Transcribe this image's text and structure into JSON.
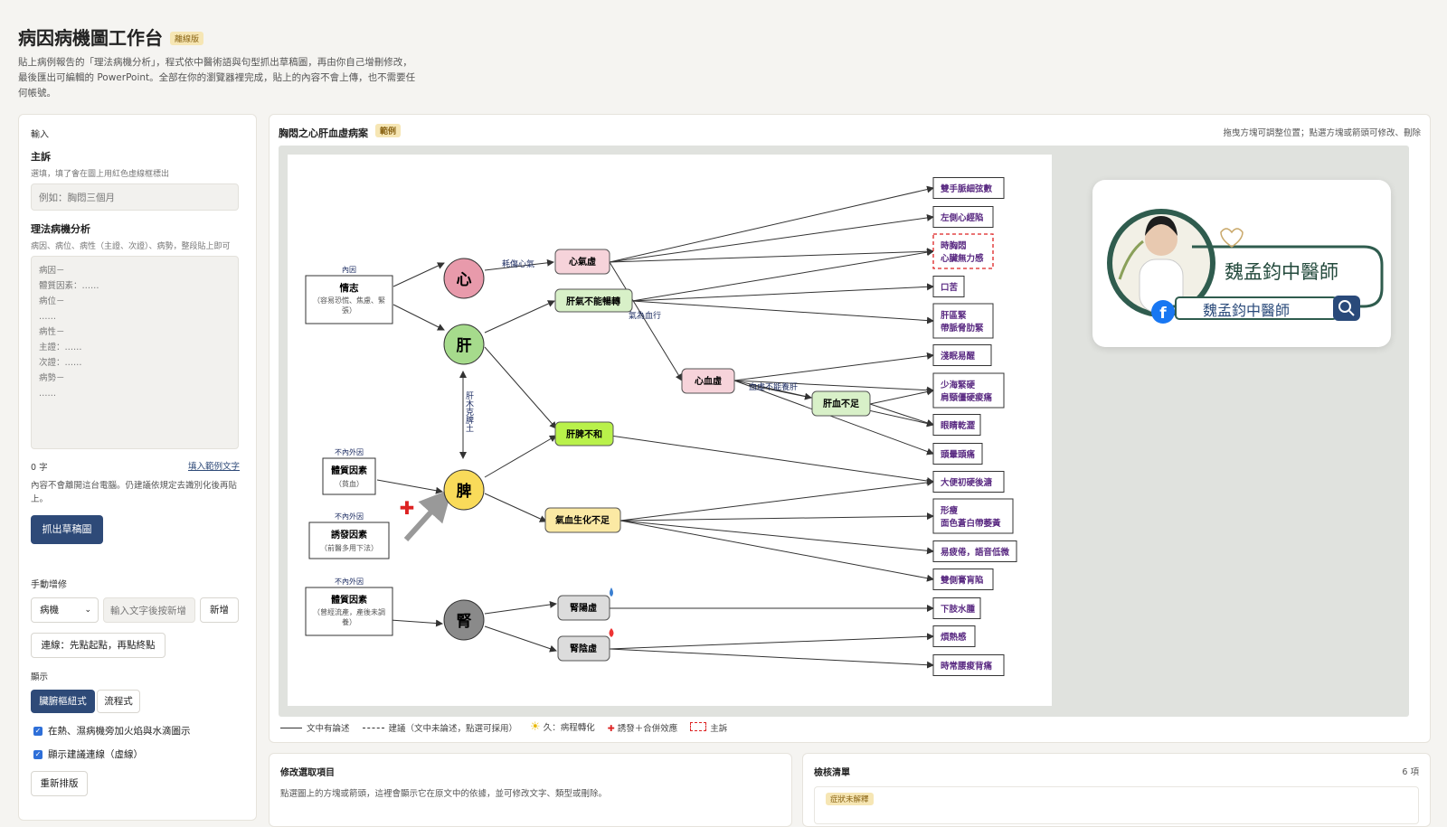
{
  "app": {
    "title": "病因病機圖工作台",
    "badge": "離線版",
    "intro": "貼上病例報告的「理法病機分析」，程式依中醫術語與句型抓出草稿圖，再由你自己增刪修改，最後匯出可編輯的 PowerPoint。全部在你的瀏覽器裡完成，貼上的內容不會上傳，也不需要任何帳號。"
  },
  "left": {
    "heading": "輸入",
    "chief_label": "主訴",
    "chief_hint": "選填，填了會在圖上用紅色虛線框標出",
    "chief_placeholder": "例如：胸悶三個月",
    "analysis_label": "理法病機分析",
    "analysis_hint": "病因、病位、病性（主證、次證）、病勢，整段貼上即可",
    "analysis_placeholder": "病因－\n體質因素：……\n病位－\n……\n病性－\n主證：……\n次證：……\n病勢－\n……",
    "char_count": "0 字",
    "fill_example": "填入範例文字",
    "privacy": "內容不會離開這台電腦。仍建議依規定去識別化後再貼上。",
    "extract_button": "抓出草稿圖",
    "manual_label": "手動增修",
    "type_select": "病機",
    "add_placeholder": "輸入文字後按新增",
    "add_button": "新增",
    "connect_button": "連線：先點起點，再點終點",
    "display_label": "顯示",
    "mode_a": "臟腑樞紐式",
    "mode_b": "流程式",
    "opt1": "在熱、濕病機旁加火焰與水滴圖示",
    "opt2": "顯示建議連線（虛線）",
    "relayout": "重新排版"
  },
  "main": {
    "case_title": "胸悶之心肝血虛病案",
    "case_badge": "範例",
    "hint": "拖曳方塊可調整位置；點選方塊或箭頭可修改、刪除",
    "legend": {
      "solid": "文中有論述",
      "dashed": "建議（文中未論述，點選可採用）",
      "sun": "久：病程轉化",
      "cross": "誘發＋合併效應",
      "chief": "主訴"
    }
  },
  "diagram": {
    "causes": [
      {
        "tag": "內因",
        "title": "情志",
        "sub": "（容易恐慌、焦慮、緊張）"
      },
      {
        "tag": "不內外因",
        "title": "體質因素",
        "sub": "（貧血）"
      },
      {
        "tag": "不內外因",
        "title": "誘發因素",
        "sub": "（前醫多用下法）"
      },
      {
        "tag": "不內外因",
        "title": "體質因素",
        "sub": "（曾經流產，產後未調養）"
      }
    ],
    "organs": {
      "heart": "心",
      "liver": "肝",
      "spleen": "脾",
      "kidney": "腎"
    },
    "mechanisms": {
      "m_heart_qi": "心氣虛",
      "m_liver_qi": "肝氣不能暢轉",
      "m_heart_blood": "心血虛",
      "m_liver_blood": "肝血不足",
      "m_liver_spleen": "肝脾不和",
      "m_qi_blood": "氣血生化不足",
      "m_kidney_yang": "腎陽虛",
      "m_kidney_yin": "腎陰虛"
    },
    "edge_labels": {
      "consume": "耗傷心氣",
      "qi_blood": "氣為血行",
      "blood_nourish": "血虛不能養肝",
      "wood_earth": "肝木克脾土"
    },
    "symptoms": [
      "雙手脈細弦數",
      "左側心經陷",
      "時胸悶\n心臟無力感",
      "口苦",
      "肝區緊\n帶脈脅肋緊",
      "淺眠易醒",
      "少海緊硬\n肩頸僵硬痠痛",
      "眼睛乾澀",
      "頭暈頭痛",
      "大便初硬後溏",
      "形瘦\n面色蒼白帶萎黃",
      "易疲倦，語音低微",
      "雙側膏肓陷",
      "下肢水腫",
      "煩熱感",
      "時常腰痠背痛"
    ]
  },
  "card": {
    "name": "魏孟鈞中醫師",
    "search_text": "魏孟鈞中醫師"
  },
  "edit_panel": {
    "title": "修改選取項目",
    "hint": "點選圖上的方塊或箭頭，這裡會顯示它在原文中的依據，並可修改文字、類型或刪除。"
  },
  "review_panel": {
    "title": "檢核清單",
    "count": "6 項",
    "first_tag": "症狀未解釋"
  },
  "colors": {
    "primary": "#2e4a78",
    "heart": "#e89aab",
    "liver": "#a6db8c",
    "spleen": "#f9db5a",
    "kidney": "#8a8a8a",
    "symptom_text": "#5a2a82",
    "chief_red": "#d22"
  }
}
